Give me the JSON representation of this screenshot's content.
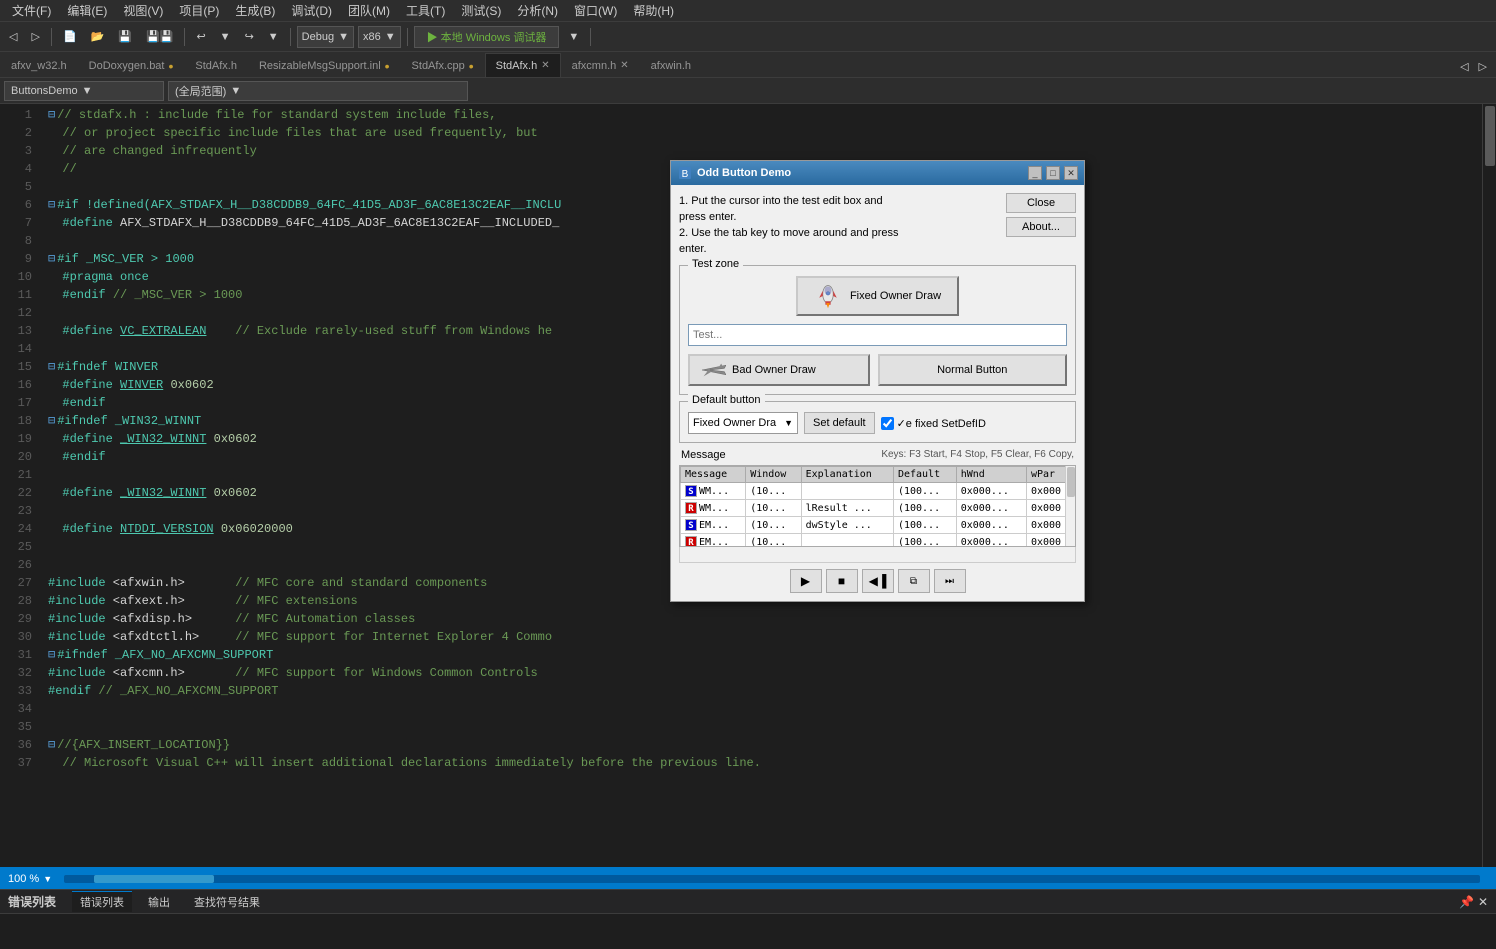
{
  "menubar": {
    "items": [
      {
        "label": "文件(F)"
      },
      {
        "label": "编辑(E)"
      },
      {
        "label": "视图(V)"
      },
      {
        "label": "项目(P)"
      },
      {
        "label": "生成(B)"
      },
      {
        "label": "调试(D)"
      },
      {
        "label": "团队(M)"
      },
      {
        "label": "工具(T)"
      },
      {
        "label": "测试(S)"
      },
      {
        "label": "分析(N)"
      },
      {
        "label": "窗口(W)"
      },
      {
        "label": "帮助(H)"
      }
    ]
  },
  "toolbar": {
    "config": "Debug",
    "arch": "x86",
    "run_label": "▶ 本地 Windows 调试器",
    "run_dropdown": "▼"
  },
  "tabs": [
    {
      "label": "afxv_w32.h",
      "dirty": false
    },
    {
      "label": "DoDoxygen.bat",
      "dirty": true
    },
    {
      "label": "StdAfx.h",
      "dirty": false
    },
    {
      "label": "ResizableMsgSupport.inl",
      "dirty": true
    },
    {
      "label": "StdAfx.cpp",
      "dirty": true
    },
    {
      "label": "StdAfx.h",
      "dirty": false,
      "active": true
    },
    {
      "label": "afxcmn.h",
      "dirty": false
    },
    {
      "label": "afxwin.h",
      "dirty": false
    }
  ],
  "scopebar": {
    "project": "ButtonsDemo",
    "scope": "(全局范围)"
  },
  "code_lines": [
    {
      "num": 1,
      "text": "// stdafx.h : include file for standard system include files,",
      "type": "comment"
    },
    {
      "num": 2,
      "text": "//   or project specific include files that are used frequently, but",
      "type": "comment"
    },
    {
      "num": 3,
      "text": "//   are changed infrequently",
      "type": "comment"
    },
    {
      "num": 4,
      "text": "//",
      "type": "comment"
    },
    {
      "num": 5,
      "text": "",
      "type": "normal"
    },
    {
      "num": 6,
      "text": "#if !defined(AFX_STDAFX_H__D38CDDB9_64FC_41D5_AD3F_6AC8E13C2EAF__INCLU",
      "type": "macro"
    },
    {
      "num": 7,
      "text": "  #define AFX_STDAFX_H__D38CDDB9_64FC_41D5_AD3F_6AC8E13C2EAF__INCLUDED_",
      "type": "normal"
    },
    {
      "num": 8,
      "text": "",
      "type": "normal"
    },
    {
      "num": 9,
      "text": "#if _MSC_VER > 1000",
      "type": "macro"
    },
    {
      "num": 10,
      "text": "  #pragma once",
      "type": "normal"
    },
    {
      "num": 11,
      "text": "  #endif // _MSC_VER > 1000",
      "type": "comment"
    },
    {
      "num": 12,
      "text": "",
      "type": "normal"
    },
    {
      "num": 13,
      "text": "  #define VC_EXTRALEAN    // Exclude rarely-used stuff from Windows he",
      "type": "macro_comment"
    },
    {
      "num": 14,
      "text": "",
      "type": "normal"
    },
    {
      "num": 15,
      "text": "#ifndef WINVER",
      "type": "macro"
    },
    {
      "num": 16,
      "text": "  #define WINVER 0x0602",
      "type": "normal"
    },
    {
      "num": 17,
      "text": "  #endif",
      "type": "normal"
    },
    {
      "num": 18,
      "text": "#ifndef _WIN32_WINNT",
      "type": "macro"
    },
    {
      "num": 19,
      "text": "  #define _WIN32_WINNT 0x0602",
      "type": "normal"
    },
    {
      "num": 20,
      "text": "  #endif",
      "type": "normal"
    },
    {
      "num": 21,
      "text": "",
      "type": "normal"
    },
    {
      "num": 22,
      "text": "  #define _WIN32_WINNT 0x0602",
      "type": "normal"
    },
    {
      "num": 23,
      "text": "",
      "type": "normal"
    },
    {
      "num": 24,
      "text": "  #define NTDDI_VERSION 0x06020000",
      "type": "normal"
    },
    {
      "num": 25,
      "text": "",
      "type": "normal"
    },
    {
      "num": 26,
      "text": "",
      "type": "normal"
    },
    {
      "num": 27,
      "text": "#include <afxwin.h>       // MFC core and standard components",
      "type": "include_comment"
    },
    {
      "num": 28,
      "text": "#include <afxext.h>       // MFC extensions",
      "type": "include_comment"
    },
    {
      "num": 29,
      "text": "#include <afxdisp.h>      // MFC Automation classes",
      "type": "include_comment"
    },
    {
      "num": 30,
      "text": "#include <afxdtctl.h>     // MFC support for Internet Explorer 4 Commo",
      "type": "include_comment"
    },
    {
      "num": 31,
      "text": "#ifndef _AFX_NO_AFXCMN_SUPPORT",
      "type": "macro"
    },
    {
      "num": 32,
      "text": "#include <afxcmn.h>      // MFC support for Windows Common Controls",
      "type": "include_comment"
    },
    {
      "num": 33,
      "text": "#endif // _AFX_NO_AFXCMN_SUPPORT",
      "type": "comment"
    },
    {
      "num": 34,
      "text": "",
      "type": "normal"
    },
    {
      "num": 35,
      "text": "",
      "type": "normal"
    },
    {
      "num": 36,
      "text": "//{AFX_INSERT_LOCATION}}",
      "type": "comment"
    },
    {
      "num": 37,
      "text": "// Microsoft Visual C++ will insert additional declarations immediately before the previous line.",
      "type": "comment"
    }
  ],
  "dialog": {
    "title": "Odd Button Demo",
    "instructions": "1. Put the cursor into the test edit box and\npress enter.\n2. Use the tab key to move around and press\nenter.",
    "close_btn": "Close",
    "about_btn": "About...",
    "test_zone_label": "Test zone",
    "fixed_owner_draw_btn": "Fixed Owner Draw",
    "test_input_placeholder": "Test...",
    "bad_owner_draw_btn": "Bad Owner Draw",
    "normal_btn": "Normal Button",
    "default_btn_label": "Default button",
    "default_dropdown_value": "Fixed Owner Dra",
    "set_default_btn": "Set default",
    "checkbox_label": "✓e fixed SetDefID",
    "message_section": {
      "label": "Message",
      "keys_hint": "Keys: F3 Start, F4 Stop, F5 Clear, F6 Copy,"
    },
    "table": {
      "columns": [
        "Message",
        "Window",
        "Explanation",
        "Default",
        "hWnd",
        "wPar"
      ],
      "rows": [
        {
          "badge": "S",
          "msg": "WM...",
          "window": "(10...",
          "explanation": "",
          "default": "(100...",
          "hwnd": "0x000...",
          "wparam": "0x000"
        },
        {
          "badge": "R",
          "msg": "WM...",
          "window": "(10...",
          "explanation": "lResult ...",
          "default": "(100...",
          "hwnd": "0x000...",
          "wparam": "0x000"
        },
        {
          "badge": "S",
          "msg": "EM...",
          "window": "(10...",
          "explanation": "dwStyle ...",
          "default": "(100...",
          "hwnd": "0x000...",
          "wparam": "0x000"
        },
        {
          "badge": "R",
          "msg": "EM...",
          "window": "(10...",
          "explanation": "",
          "default": "(100...",
          "hwnd": "0x000...",
          "wparam": "0x000"
        }
      ]
    },
    "playback_btns": [
      "▶",
      "■",
      "◀▐",
      "⧉",
      "⏭"
    ]
  },
  "statusbar": {
    "zoom": "100 %",
    "zoom_arrow": "▼"
  },
  "error_panel": {
    "tabs": [
      {
        "label": "错误列表",
        "active": true
      },
      {
        "label": "输出"
      },
      {
        "label": "查找符号结果"
      }
    ],
    "panel_title": "错误列表"
  }
}
